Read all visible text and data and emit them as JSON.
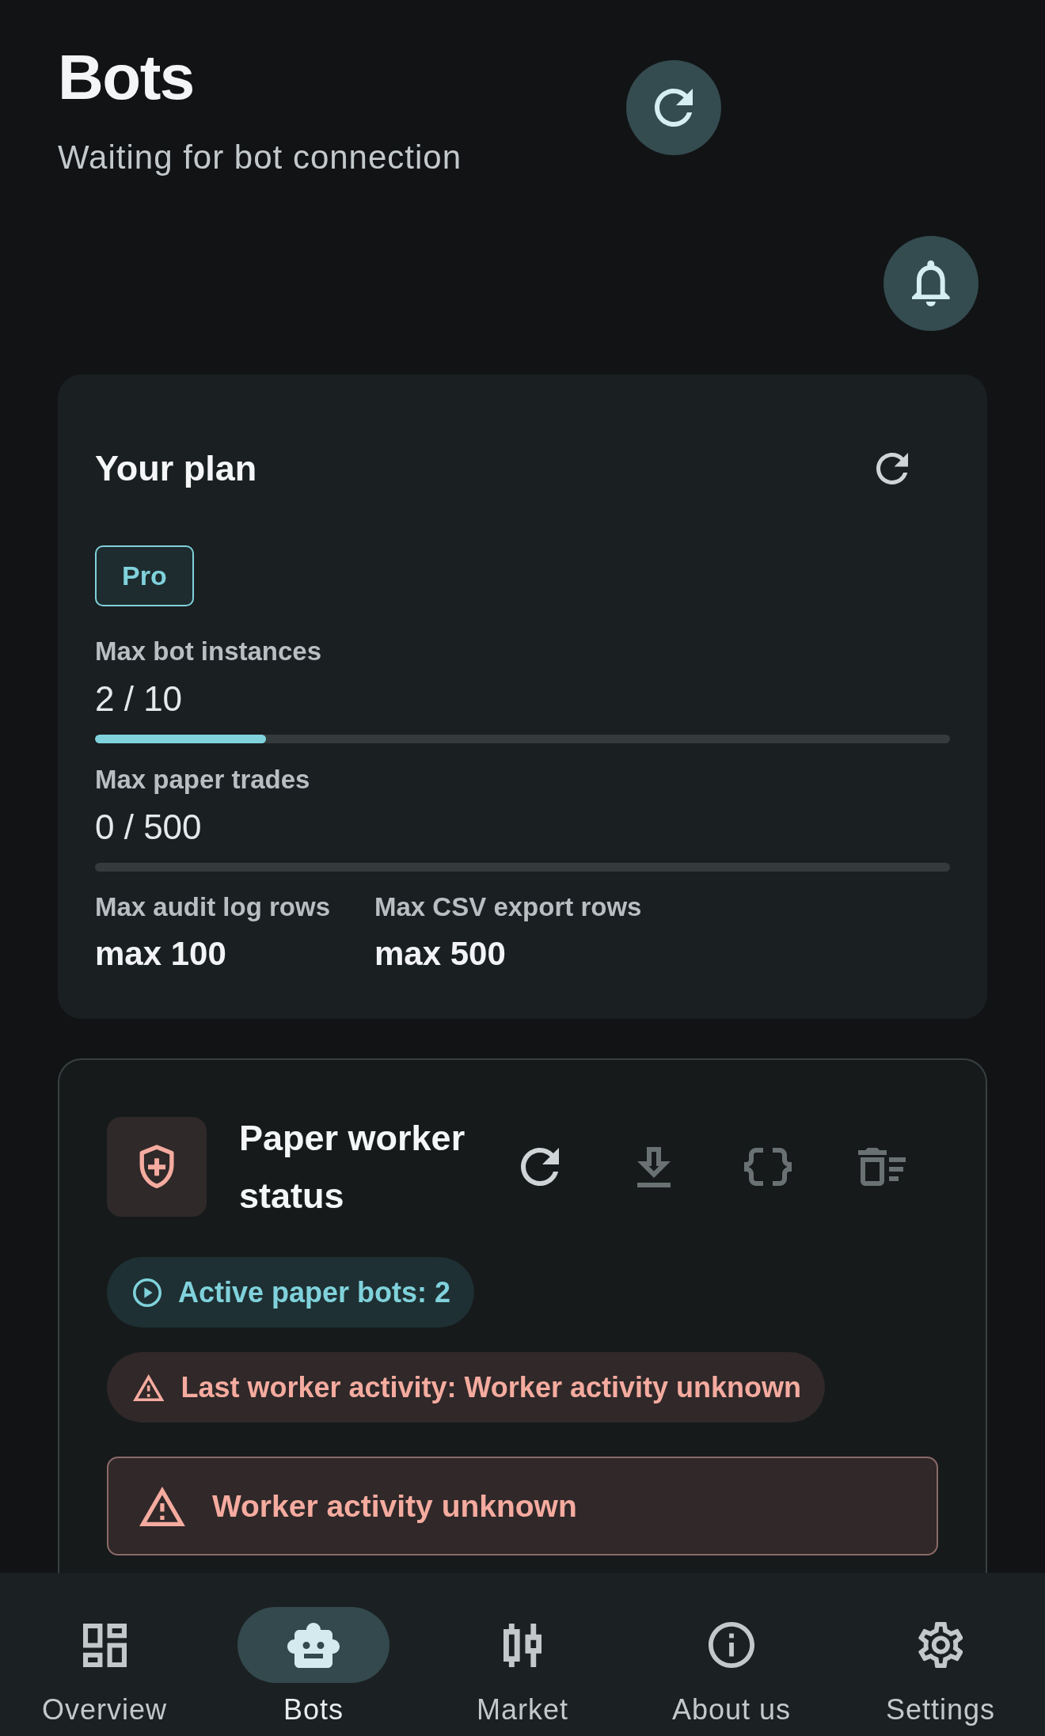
{
  "header": {
    "title": "Bots",
    "subtitle": "Waiting for bot connection"
  },
  "plan": {
    "title": "Your plan",
    "tier": "Pro",
    "limits": [
      {
        "label": "Max bot instances",
        "reading": "2 / 10",
        "level": 0.2
      },
      {
        "label": "Max paper trades",
        "reading": "0 / 500"
      }
    ],
    "caps": [
      {
        "label": "Max audit log rows",
        "value": "max 100"
      },
      {
        "label": "Max CSV export rows",
        "value": "max 500"
      }
    ]
  },
  "worker": {
    "title": "Paper worker status",
    "actions": [
      {
        "kind": "refresh",
        "disabled": false
      },
      {
        "kind": "download",
        "disabled": true
      },
      {
        "kind": "json",
        "disabled": true
      },
      {
        "kind": "clear",
        "disabled": true
      }
    ],
    "chips": [
      {
        "kind": "info",
        "text": "Active paper bots: 2"
      },
      {
        "kind": "warning",
        "text": "Last worker activity: Worker activity unknown"
      }
    ],
    "alert": {
      "kind": "warning",
      "text": "Worker activity unknown"
    }
  },
  "nav": [
    {
      "kind": "overview",
      "label": "Overview",
      "selected": false
    },
    {
      "kind": "bots",
      "label": "Bots",
      "selected": true
    },
    {
      "kind": "market",
      "label": "Market",
      "selected": false
    },
    {
      "kind": "about",
      "label": "About us",
      "selected": false
    },
    {
      "kind": "settings",
      "label": "Settings",
      "selected": false
    }
  ]
}
